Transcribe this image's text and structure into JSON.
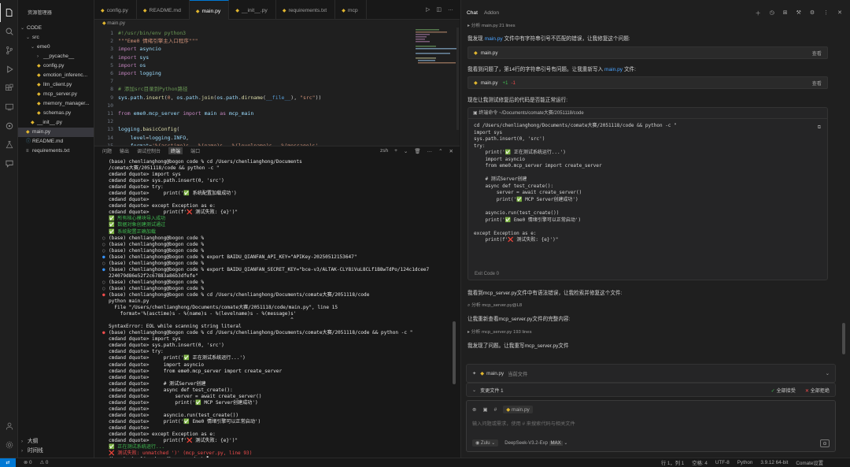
{
  "explorer": {
    "title": "资源管理器",
    "items": [
      {
        "label": "CODE",
        "kind": "folder-open",
        "indent": 0
      },
      {
        "label": "src",
        "kind": "folder-open",
        "indent": 1
      },
      {
        "label": "eme0",
        "kind": "folder-open",
        "indent": 2
      },
      {
        "label": "__pycache__",
        "kind": "folder",
        "indent": 3
      },
      {
        "label": "config.py",
        "kind": "py",
        "indent": 3
      },
      {
        "label": "emotion_inferenc...",
        "kind": "py",
        "indent": 3
      },
      {
        "label": "llm_client.py",
        "kind": "py",
        "indent": 3
      },
      {
        "label": "mcp_server.py",
        "kind": "py",
        "indent": 3
      },
      {
        "label": "memory_manager...",
        "kind": "py",
        "indent": 3
      },
      {
        "label": "schemas.py",
        "kind": "py",
        "indent": 3
      },
      {
        "label": "__init__.py",
        "kind": "py",
        "indent": 2
      },
      {
        "label": "main.py",
        "kind": "py",
        "indent": 1,
        "selected": true
      },
      {
        "label": "README.md",
        "kind": "md",
        "indent": 1
      },
      {
        "label": "requirements.txt",
        "kind": "txt",
        "indent": 1
      }
    ],
    "outline": "大纲",
    "timeline": "时间线"
  },
  "editor": {
    "tabs": [
      "config.py",
      "README.md",
      "main.py",
      "__init__.py",
      "requirements.txt",
      "mcp"
    ],
    "active_tab": 2,
    "breadcrumb": "main.py",
    "lines": [
      {
        "n": "1",
        "html": "<span class='cm'>#!/usr/bin/env python3</span>"
      },
      {
        "n": "2",
        "html": "<span class='st'>\"\"\"Eme0 情绪引擎主入口程序\"\"\"</span>"
      },
      {
        "n": "3",
        "html": "<span class='kw'>import</span> <span class='nm'>asyncio</span>"
      },
      {
        "n": "4",
        "html": "<span class='kw'>import</span> <span class='nm'>sys</span>"
      },
      {
        "n": "5",
        "html": "<span class='kw'>import</span> <span class='nm'>os</span>"
      },
      {
        "n": "6",
        "html": "<span class='kw'>import</span> <span class='nm'>logging</span>"
      },
      {
        "n": "7",
        "html": ""
      },
      {
        "n": "8",
        "html": "<span class='cm'># 添加src目录到Python路径</span>"
      },
      {
        "n": "9",
        "html": "<span class='nm'>sys</span>.<span class='nm'>path</span>.<span class='fn'>insert</span>(<span class='st'>0</span>, <span class='nm'>os</span>.<span class='nm'>path</span>.<span class='fn'>join</span>(<span class='nm'>os</span>.<span class='nm'>path</span>.<span class='fn'>dirname</span>(<span class='bl'>__file__</span>), <span class='st'>\"src\"</span>))"
      },
      {
        "n": "10",
        "html": ""
      },
      {
        "n": "11",
        "html": "<span class='kw'>from</span> <span class='nm'>eme0.mcp_server</span> <span class='kw'>import</span> <span class='nm'>main</span> <span class='kw'>as</span> <span class='nm'>mcp_main</span>"
      },
      {
        "n": "12",
        "html": ""
      },
      {
        "n": "13",
        "html": "<span class='nm'>logging</span>.<span class='fn'>basicConfig</span>("
      },
      {
        "n": "14",
        "html": "    <span class='nm'>level</span>=<span class='nm'>logging</span>.<span class='nm'>INFO</span>,"
      },
      {
        "n": "15",
        "html": "    <span class='nm'>format</span>=<span class='st'>'%(asctime)s - %(name)s - %(levelname)s - %(message)s'</span>"
      }
    ]
  },
  "panel": {
    "tabs": [
      "问题",
      "输出",
      "调试控制台",
      "终端",
      "端口"
    ],
    "active_tab": 3,
    "tools": [
      "zsh",
      "+",
      "⌄",
      "🗑",
      "…",
      "⌃",
      "✕"
    ],
    "lines": [
      {
        "m": "",
        "t": "(base) chenlianghong@bogon code % cd /Users/chenlianghong/Documents"
      },
      {
        "m": "",
        "t": "/comate大赛/2051118/code && python -c \""
      },
      {
        "m": "",
        "t": "cmdand dquote> import sys"
      },
      {
        "m": "",
        "t": "cmdand dquote> sys.path.insert(0, 'src')"
      },
      {
        "m": "",
        "t": "cmdand dquote> try:"
      },
      {
        "m": "",
        "t": "cmdand dquote>     print('✅ 系统配置加载成功')"
      },
      {
        "m": "",
        "t": "cmdand dquote>"
      },
      {
        "m": "",
        "t": "cmdand dquote> except Exception as e:"
      },
      {
        "m": "",
        "t": "cmdand dquote>     print(f'❌ 测试失败: {e}')\""
      },
      {
        "m": "",
        "t": "✅ 所有核心模块导入成功",
        "c": "ok"
      },
      {
        "m": "",
        "t": "✅ 数据对象创建测试通过",
        "c": "ok"
      },
      {
        "m": "",
        "t": "✅ 系统配置正确加载",
        "c": "ok"
      },
      {
        "m": "hollow",
        "t": "(base) chenlianghong@bogon code %"
      },
      {
        "m": "hollow",
        "t": "(base) chenlianghong@bogon code %"
      },
      {
        "m": "hollow",
        "t": "(base) chenlianghong@bogon code %"
      },
      {
        "m": "blue",
        "t": "(base) chenlianghong@bogon code % export BAIDU_QIANFAN_API_KEY=\"APIKey-20250512153647\""
      },
      {
        "m": "hollow",
        "t": "(base) chenlianghong@bogon code %"
      },
      {
        "m": "blue",
        "t": "(base) chenlianghong@bogon code % export BAIDU_QIANFAN_SECRET_KEY=\"bce-v3/ALTAK-CLY8iVuL8CLf1B8wTdPo/124c1dcee7"
      },
      {
        "m": "",
        "t": "224079d86e52f2c67883a86b3dfefe\""
      },
      {
        "m": "hollow",
        "t": "(base) chenlianghong@bogon code %"
      },
      {
        "m": "hollow",
        "t": "(base) chenlianghong@bogon code %"
      },
      {
        "m": "red",
        "t": "(base) chenlianghong@bogon code % cd /Users/chenlianghong/Documents/comate大赛/2051118/code"
      },
      {
        "m": "",
        "t": "python main.py"
      },
      {
        "m": "",
        "t": "  File \"/Users/chenlianghong/Documents/comate大赛/2051118/code/main.py\", line 15"
      },
      {
        "m": "",
        "t": "    format='%(asctime)s - %(name)s - %(levelname)s - %(message)s'"
      },
      {
        "m": "",
        "t": "                                                               ^"
      },
      {
        "m": "",
        "t": "SyntaxError: EOL while scanning string literal"
      },
      {
        "m": "red",
        "t": "(base) chenlianghong@bogon code % cd /Users/chenlianghong/Documents/comate大赛/2051118/code && python -c \""
      },
      {
        "m": "",
        "t": "cmdand dquote> import sys"
      },
      {
        "m": "",
        "t": "cmdand dquote> sys.path.insert(0, 'src')"
      },
      {
        "m": "",
        "t": "cmdand dquote> try:"
      },
      {
        "m": "",
        "t": "cmdand dquote>     print('✅ 正在测试系统运行...')"
      },
      {
        "m": "",
        "t": "cmdand dquote>     import asyncio"
      },
      {
        "m": "",
        "t": "cmdand dquote>     from eme0.mcp_server import create_server"
      },
      {
        "m": "",
        "t": "cmdand dquote>"
      },
      {
        "m": "",
        "t": "cmdand dquote>     # 测试Server创建"
      },
      {
        "m": "",
        "t": "cmdand dquote>     async def test_create():"
      },
      {
        "m": "",
        "t": "cmdand dquote>         server = await create_server()"
      },
      {
        "m": "",
        "t": "cmdand dquote>         print('✅ MCP Server创建成功')"
      },
      {
        "m": "",
        "t": "cmdand dquote>"
      },
      {
        "m": "",
        "t": "cmdand dquote>     asyncio.run(test_create())"
      },
      {
        "m": "",
        "t": "cmdand dquote>     print('✅ Eme0 情绪引擎可以正常启动')"
      },
      {
        "m": "",
        "t": "cmdand dquote>"
      },
      {
        "m": "",
        "t": "cmdand dquote> except Exception as e:"
      },
      {
        "m": "",
        "t": "cmdand dquote>     print(f'❌ 测试失败: {e}')\""
      },
      {
        "m": "",
        "t": "✅ 正在测试系统运行...",
        "c": "ok"
      },
      {
        "m": "",
        "t": "❌ 测试失败: unmatched ')' (mcp_server.py, line 93)",
        "c": "err"
      },
      {
        "m": "hollow",
        "t": "(base) chenlianghong@bogon code % ▌"
      }
    ]
  },
  "chat": {
    "tabs": [
      "Chat",
      "Addon"
    ],
    "active_tab": 0,
    "read_meta": "分析 main.py 21 lines",
    "msg1_pre": "我发现 ",
    "msg1_link": "main.py",
    "msg1_post": " 文件中有字符串引号不匹配的错误，让我修复这个问题:",
    "file1": {
      "name": "main.py",
      "action": "查看"
    },
    "msg2_pre": "我看到问题了，第14行的字符串引号有问题。让我重新写入 ",
    "msg2_link": "main.py",
    "msg2_post": " 文件:",
    "file2": {
      "name": "main.py",
      "plus": "+1",
      "minus": "-1",
      "action": "查看"
    },
    "msg3": "现在让我测试修复后的代码是否能正常运行:",
    "run_header": "终端命令  ~/Documents/comate大赛/2051118/code",
    "run_lines": [
      "cd /Users/chenlianghong/Documents/comate大赛/2051118/code && python -c \"",
      "import sys",
      "sys.path.insert(0, 'src')",
      "try:",
      "    print('✅ 正在测试系统运行...')",
      "    import asyncio",
      "    from eme0.mcp_server import create_server",
      "",
      "    # 测试Server创建",
      "    async def test_create():",
      "        server = await create_server()",
      "        print('✅ MCP Server创建成功')",
      "",
      "    asyncio.run(test_create())",
      "    print('✅ Eme0 情绪引擎可以正常启动')",
      "",
      "except Exception as e:",
      "    print(f'❌ 测试失败: {e}')\""
    ],
    "exit_code": "Exit Code 0",
    "msg4": "我看到mcp_server.py文件中有语法错误，让我检索并修复这个文件:",
    "search_meta": "分析 mcp_server.py@L8",
    "msg5": "让我重新查看mcp_server.py文件的完整内容:",
    "read2_meta": "分析 mcp_server.py 193 lines",
    "msg6": "我发现了问题。让我重写mcp_server.py文件",
    "composer": {
      "file_chip": "main.py",
      "file_chip_sub": "当前文件",
      "changes": "变更文件 1",
      "accept_all": "全部接受",
      "reject_all": "全部拒绝",
      "ctx_chip": "main.py",
      "placeholder": "输入问题或需求，使用 # 来搜索代码与相关文件",
      "mode": "Zulu",
      "model": "DeepSeek-V3.2-Exp",
      "model_badge": "MAX"
    }
  },
  "statusbar": {
    "remote": "⇄",
    "errors": "⊗ 0",
    "warnings": "⚠ 0",
    "position": "行 1，列 1",
    "spaces": "空格: 4",
    "encoding": "UTF-8",
    "language": "Python",
    "interpreter": "3.9.12 64-bit",
    "account": "Comate设置"
  }
}
